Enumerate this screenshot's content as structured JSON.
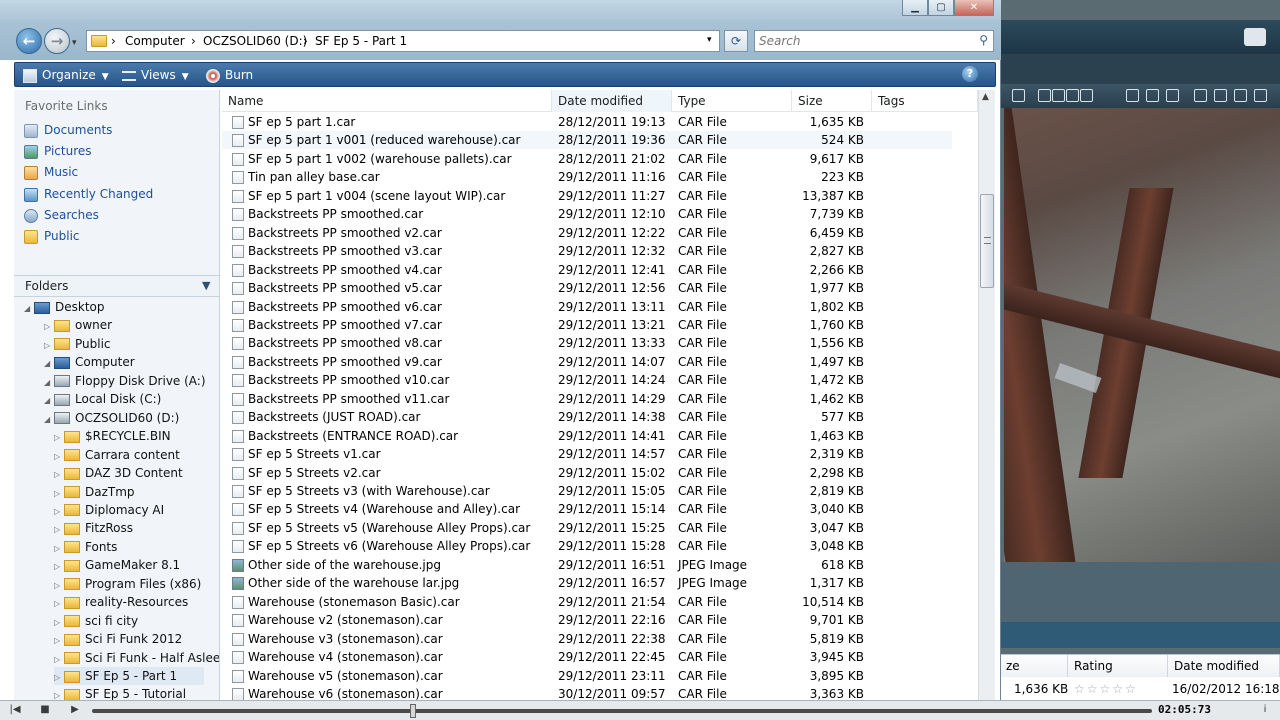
{
  "nav": {
    "address": [
      "Computer",
      "OCZSOLID60 (D:)",
      "SF Ep 5 - Part 1"
    ],
    "search_placeholder": "Search"
  },
  "toolbar": {
    "organize": "Organize",
    "views": "Views",
    "burn": "Burn"
  },
  "favorites": {
    "heading": "Favorite Links",
    "items": [
      "Documents",
      "Pictures",
      "Music",
      "Recently Changed",
      "Searches",
      "Public"
    ]
  },
  "folders": {
    "heading": "Folders",
    "tree": [
      {
        "label": "Desktop",
        "level": 0
      },
      {
        "label": "owner",
        "level": 1
      },
      {
        "label": "Public",
        "level": 1
      },
      {
        "label": "Computer",
        "level": 1
      },
      {
        "label": "Floppy Disk Drive (A:)",
        "level": 2
      },
      {
        "label": "Local Disk (C:)",
        "level": 2
      },
      {
        "label": "OCZSOLID60 (D:)",
        "level": 2
      },
      {
        "label": "$RECYCLE.BIN",
        "level": 3
      },
      {
        "label": "Carrara content",
        "level": 3
      },
      {
        "label": "DAZ 3D Content",
        "level": 3
      },
      {
        "label": "DazTmp",
        "level": 3
      },
      {
        "label": "Diplomacy AI",
        "level": 3
      },
      {
        "label": "FitzRoss",
        "level": 3
      },
      {
        "label": "Fonts",
        "level": 3
      },
      {
        "label": "GameMaker 8.1",
        "level": 3
      },
      {
        "label": "Program Files (x86)",
        "level": 3
      },
      {
        "label": "reality-Resources",
        "level": 3
      },
      {
        "label": "sci fi city",
        "level": 3
      },
      {
        "label": "Sci Fi Funk 2012",
        "level": 3
      },
      {
        "label": "Sci Fi Funk - Half Asleep",
        "level": 3
      },
      {
        "label": "SF Ep 5 - Part 1",
        "level": 3
      },
      {
        "label": "SF Ep 5 - Tutorial",
        "level": 3
      }
    ]
  },
  "columns": [
    "Name",
    "Date modified",
    "Type",
    "Size",
    "Tags"
  ],
  "files": [
    {
      "name": "SF ep 5 part 1.car",
      "date": "28/12/2011 19:13",
      "type": "CAR File",
      "size": "1,635 KB"
    },
    {
      "name": "SF ep 5 part 1 v001 (reduced warehouse).car",
      "date": "28/12/2011 19:36",
      "type": "CAR File",
      "size": "524 KB"
    },
    {
      "name": "SF ep 5 part 1 v002 (warehouse pallets).car",
      "date": "28/12/2011 21:02",
      "type": "CAR File",
      "size": "9,617 KB"
    },
    {
      "name": "Tin pan alley base.car",
      "date": "29/12/2011 11:16",
      "type": "CAR File",
      "size": "223 KB"
    },
    {
      "name": "SF ep 5 part 1 v004 (scene layout WIP).car",
      "date": "29/12/2011 11:27",
      "type": "CAR File",
      "size": "13,387 KB"
    },
    {
      "name": "Backstreets PP smoothed.car",
      "date": "29/12/2011 12:10",
      "type": "CAR File",
      "size": "7,739 KB"
    },
    {
      "name": "Backstreets PP smoothed v2.car",
      "date": "29/12/2011 12:22",
      "type": "CAR File",
      "size": "6,459 KB"
    },
    {
      "name": "Backstreets PP smoothed v3.car",
      "date": "29/12/2011 12:32",
      "type": "CAR File",
      "size": "2,827 KB"
    },
    {
      "name": "Backstreets PP smoothed v4.car",
      "date": "29/12/2011 12:41",
      "type": "CAR File",
      "size": "2,266 KB"
    },
    {
      "name": "Backstreets PP smoothed v5.car",
      "date": "29/12/2011 12:56",
      "type": "CAR File",
      "size": "1,977 KB"
    },
    {
      "name": "Backstreets PP smoothed v6.car",
      "date": "29/12/2011 13:11",
      "type": "CAR File",
      "size": "1,802 KB"
    },
    {
      "name": "Backstreets PP smoothed v7.car",
      "date": "29/12/2011 13:21",
      "type": "CAR File",
      "size": "1,760 KB"
    },
    {
      "name": "Backstreets PP smoothed v8.car",
      "date": "29/12/2011 13:33",
      "type": "CAR File",
      "size": "1,556 KB"
    },
    {
      "name": "Backstreets PP smoothed v9.car",
      "date": "29/12/2011 14:07",
      "type": "CAR File",
      "size": "1,497 KB"
    },
    {
      "name": "Backstreets PP smoothed v10.car",
      "date": "29/12/2011 14:24",
      "type": "CAR File",
      "size": "1,472 KB"
    },
    {
      "name": "Backstreets PP smoothed v11.car",
      "date": "29/12/2011 14:29",
      "type": "CAR File",
      "size": "1,462 KB"
    },
    {
      "name": "Backstreets (JUST ROAD).car",
      "date": "29/12/2011 14:38",
      "type": "CAR File",
      "size": "577 KB"
    },
    {
      "name": "Backstreets (ENTRANCE ROAD).car",
      "date": "29/12/2011 14:41",
      "type": "CAR File",
      "size": "1,463 KB"
    },
    {
      "name": "SF ep 5 Streets v1.car",
      "date": "29/12/2011 14:57",
      "type": "CAR File",
      "size": "2,319 KB"
    },
    {
      "name": "SF ep 5 Streets v2.car",
      "date": "29/12/2011 15:02",
      "type": "CAR File",
      "size": "2,298 KB"
    },
    {
      "name": "SF ep 5 Streets v3 (with Warehouse).car",
      "date": "29/12/2011 15:05",
      "type": "CAR File",
      "size": "2,819 KB"
    },
    {
      "name": "SF ep 5 Streets v4 (Warehouse and Alley).car",
      "date": "29/12/2011 15:14",
      "type": "CAR File",
      "size": "3,040 KB"
    },
    {
      "name": "SF ep 5 Streets v5 (Warehouse Alley Props).car",
      "date": "29/12/2011 15:25",
      "type": "CAR File",
      "size": "3,047 KB"
    },
    {
      "name": "SF ep 5 Streets v6 (Warehouse Alley Props).car",
      "date": "29/12/2011 15:28",
      "type": "CAR File",
      "size": "3,048 KB"
    },
    {
      "name": "Other side of the warehouse.jpg",
      "date": "29/12/2011 16:51",
      "type": "JPEG Image",
      "size": "618 KB"
    },
    {
      "name": "Other side of the warehouse lar.jpg",
      "date": "29/12/2011 16:57",
      "type": "JPEG Image",
      "size": "1,317 KB"
    },
    {
      "name": "Warehouse (stonemason Basic).car",
      "date": "29/12/2011 21:54",
      "type": "CAR File",
      "size": "10,514 KB"
    },
    {
      "name": "Warehouse v2 (stonemason).car",
      "date": "29/12/2011 22:16",
      "type": "CAR File",
      "size": "9,701 KB"
    },
    {
      "name": "Warehouse v3 (stonemason).car",
      "date": "29/12/2011 22:38",
      "type": "CAR File",
      "size": "5,819 KB"
    },
    {
      "name": "Warehouse v4 (stonemason).car",
      "date": "29/12/2011 22:45",
      "type": "CAR File",
      "size": "3,945 KB"
    },
    {
      "name": "Warehouse v5 (stonemason).car",
      "date": "29/12/2011 23:11",
      "type": "CAR File",
      "size": "3,895 KB"
    },
    {
      "name": "Warehouse v6 (stonemason).car",
      "date": "30/12/2011 09:57",
      "type": "CAR File",
      "size": "3,363 KB"
    }
  ],
  "background_app": {
    "grid_headers": [
      "ze",
      "Rating",
      "Date modified"
    ],
    "grid_row": {
      "size": "1,636 KB",
      "date": "16/02/2012 16:18"
    }
  },
  "player": {
    "time": "02:05:73",
    "progress_fraction": 0.3
  }
}
